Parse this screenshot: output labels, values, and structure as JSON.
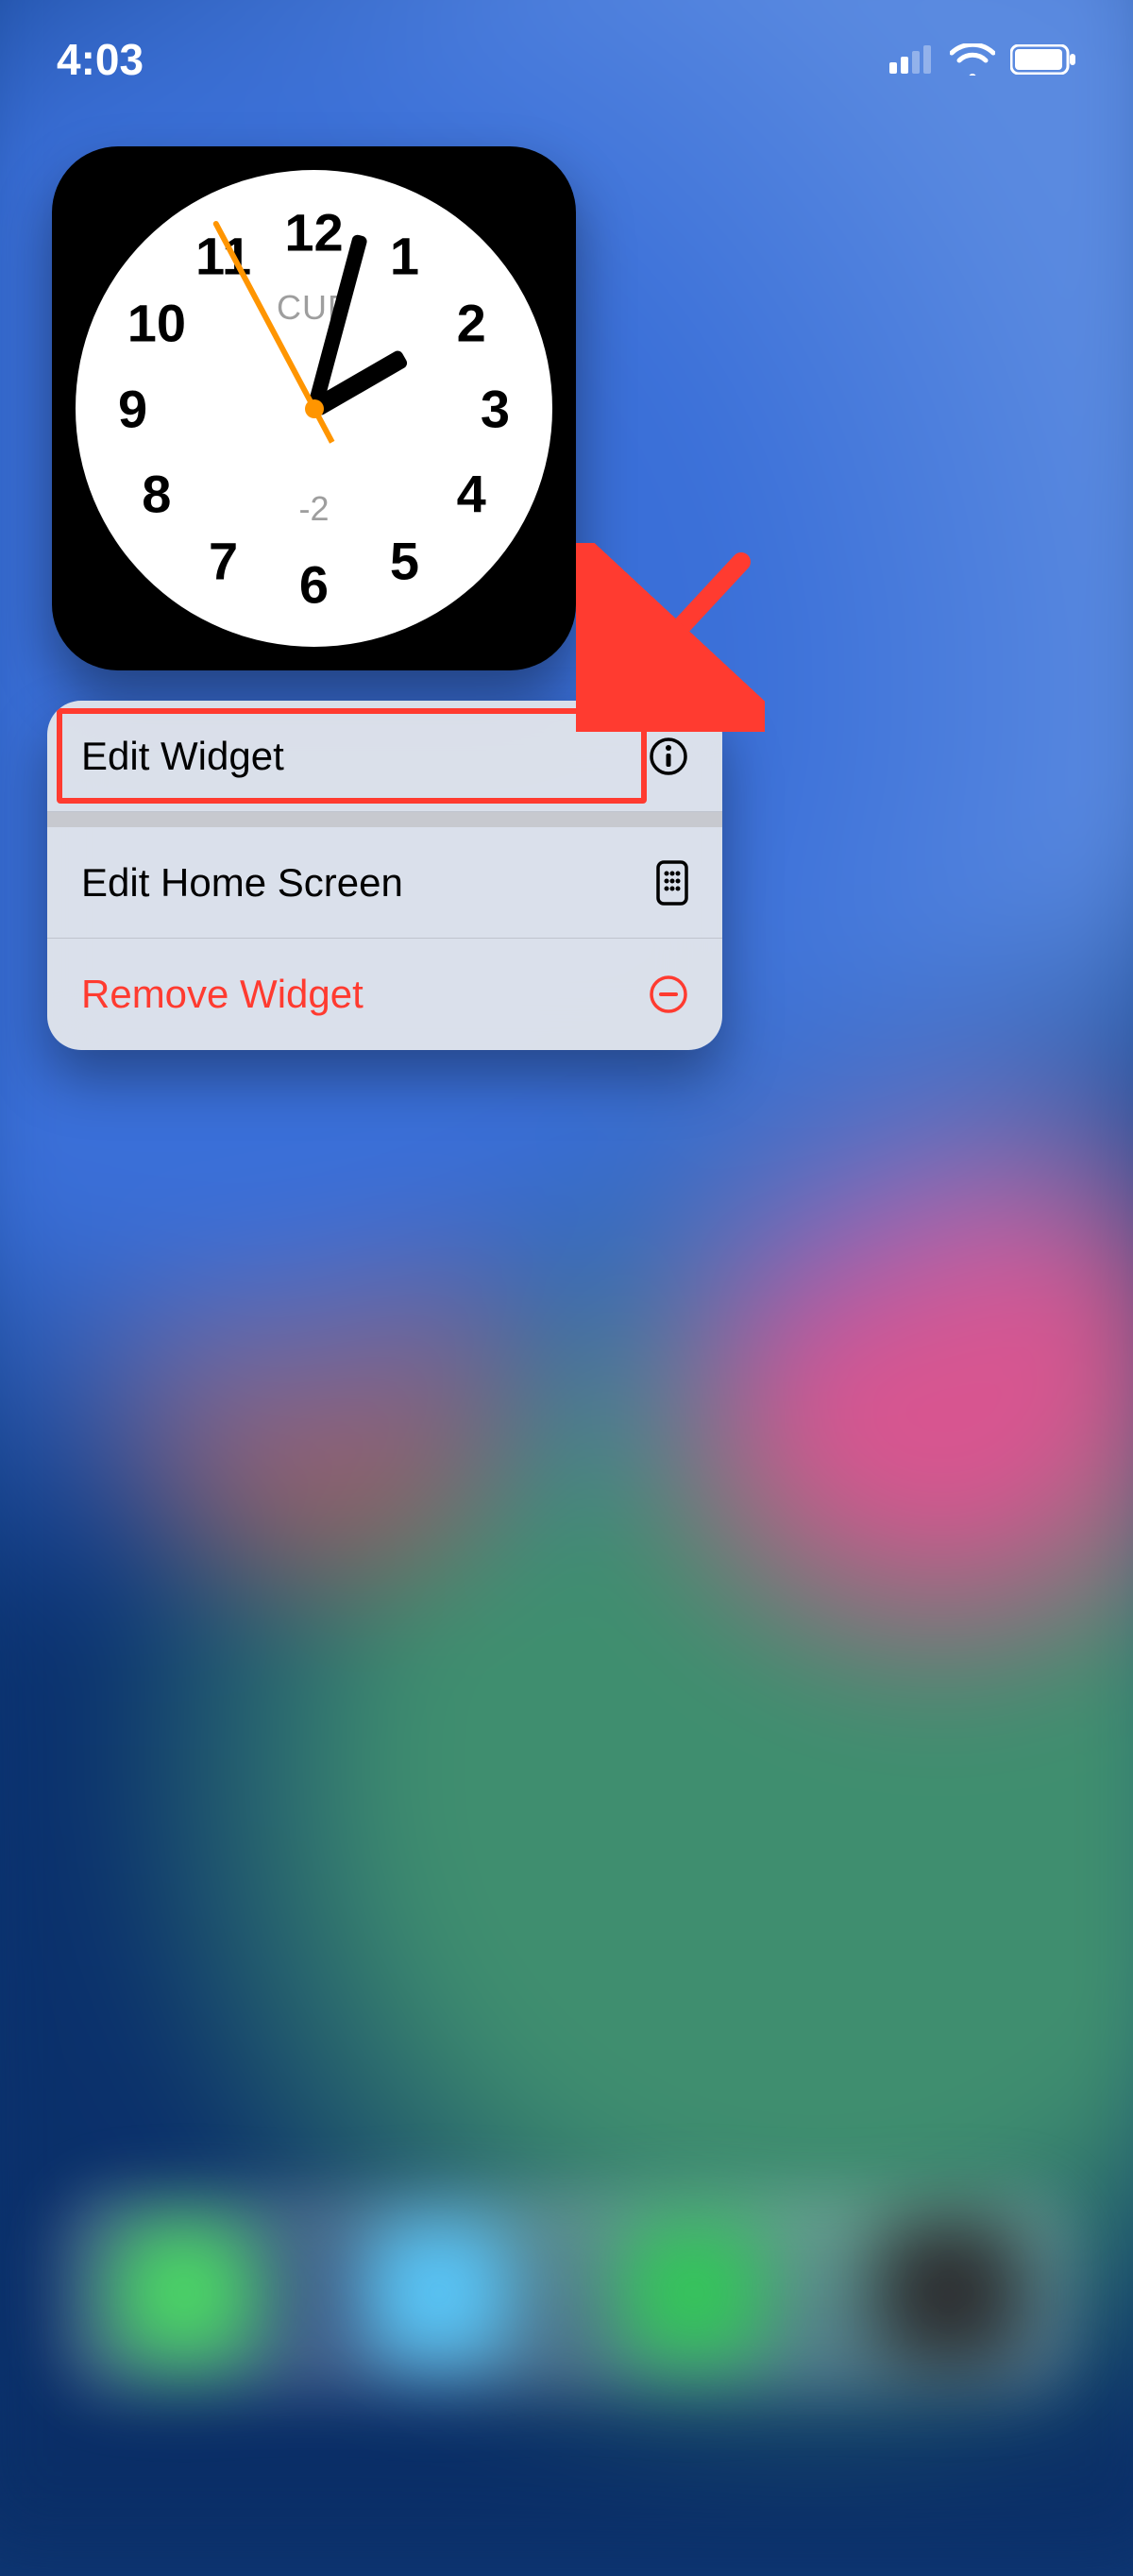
{
  "status_bar": {
    "time": "4:03",
    "cellular_bars": 2,
    "wifi_on": true,
    "battery_level": 90
  },
  "clock_widget": {
    "brand": "CUP",
    "offset": "-2",
    "hour_angle": 60,
    "minute_angle": 15,
    "second_angle": -28,
    "hour_numbers": [
      "12",
      "1",
      "2",
      "3",
      "4",
      "5",
      "6",
      "7",
      "8",
      "9",
      "10",
      "11"
    ]
  },
  "context_menu": {
    "items": [
      {
        "label": "Edit Widget",
        "icon": "info-icon",
        "destructive": false
      },
      {
        "label": "Edit Home Screen",
        "icon": "apps-phone-icon",
        "destructive": false
      },
      {
        "label": "Remove Widget",
        "icon": "circle-minus-icon",
        "destructive": true
      }
    ],
    "highlighted_index": 0
  },
  "annotation": {
    "arrow_color": "#ff3b30"
  }
}
